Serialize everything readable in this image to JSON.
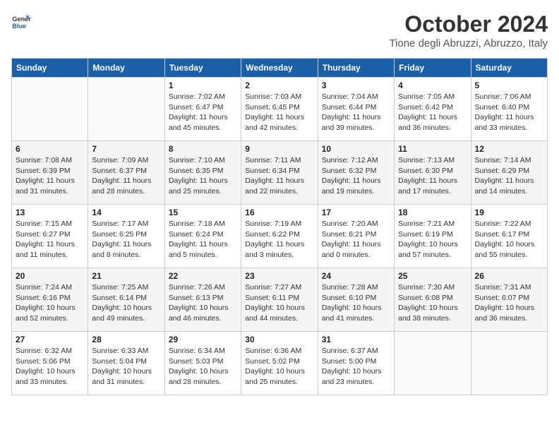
{
  "header": {
    "logo_general": "General",
    "logo_blue": "Blue",
    "month_year": "October 2024",
    "location": "Tione degli Abruzzi, Abruzzo, Italy"
  },
  "weekdays": [
    "Sunday",
    "Monday",
    "Tuesday",
    "Wednesday",
    "Thursday",
    "Friday",
    "Saturday"
  ],
  "weeks": [
    [
      {
        "day": "",
        "sunrise": "",
        "sunset": "",
        "daylight": ""
      },
      {
        "day": "",
        "sunrise": "",
        "sunset": "",
        "daylight": ""
      },
      {
        "day": "1",
        "sunrise": "Sunrise: 7:02 AM",
        "sunset": "Sunset: 6:47 PM",
        "daylight": "Daylight: 11 hours and 45 minutes."
      },
      {
        "day": "2",
        "sunrise": "Sunrise: 7:03 AM",
        "sunset": "Sunset: 6:45 PM",
        "daylight": "Daylight: 11 hours and 42 minutes."
      },
      {
        "day": "3",
        "sunrise": "Sunrise: 7:04 AM",
        "sunset": "Sunset: 6:44 PM",
        "daylight": "Daylight: 11 hours and 39 minutes."
      },
      {
        "day": "4",
        "sunrise": "Sunrise: 7:05 AM",
        "sunset": "Sunset: 6:42 PM",
        "daylight": "Daylight: 11 hours and 36 minutes."
      },
      {
        "day": "5",
        "sunrise": "Sunrise: 7:06 AM",
        "sunset": "Sunset: 6:40 PM",
        "daylight": "Daylight: 11 hours and 33 minutes."
      }
    ],
    [
      {
        "day": "6",
        "sunrise": "Sunrise: 7:08 AM",
        "sunset": "Sunset: 6:39 PM",
        "daylight": "Daylight: 11 hours and 31 minutes."
      },
      {
        "day": "7",
        "sunrise": "Sunrise: 7:09 AM",
        "sunset": "Sunset: 6:37 PM",
        "daylight": "Daylight: 11 hours and 28 minutes."
      },
      {
        "day": "8",
        "sunrise": "Sunrise: 7:10 AM",
        "sunset": "Sunset: 6:35 PM",
        "daylight": "Daylight: 11 hours and 25 minutes."
      },
      {
        "day": "9",
        "sunrise": "Sunrise: 7:11 AM",
        "sunset": "Sunset: 6:34 PM",
        "daylight": "Daylight: 11 hours and 22 minutes."
      },
      {
        "day": "10",
        "sunrise": "Sunrise: 7:12 AM",
        "sunset": "Sunset: 6:32 PM",
        "daylight": "Daylight: 11 hours and 19 minutes."
      },
      {
        "day": "11",
        "sunrise": "Sunrise: 7:13 AM",
        "sunset": "Sunset: 6:30 PM",
        "daylight": "Daylight: 11 hours and 17 minutes."
      },
      {
        "day": "12",
        "sunrise": "Sunrise: 7:14 AM",
        "sunset": "Sunset: 6:29 PM",
        "daylight": "Daylight: 11 hours and 14 minutes."
      }
    ],
    [
      {
        "day": "13",
        "sunrise": "Sunrise: 7:15 AM",
        "sunset": "Sunset: 6:27 PM",
        "daylight": "Daylight: 11 hours and 11 minutes."
      },
      {
        "day": "14",
        "sunrise": "Sunrise: 7:17 AM",
        "sunset": "Sunset: 6:25 PM",
        "daylight": "Daylight: 11 hours and 8 minutes."
      },
      {
        "day": "15",
        "sunrise": "Sunrise: 7:18 AM",
        "sunset": "Sunset: 6:24 PM",
        "daylight": "Daylight: 11 hours and 5 minutes."
      },
      {
        "day": "16",
        "sunrise": "Sunrise: 7:19 AM",
        "sunset": "Sunset: 6:22 PM",
        "daylight": "Daylight: 11 hours and 3 minutes."
      },
      {
        "day": "17",
        "sunrise": "Sunrise: 7:20 AM",
        "sunset": "Sunset: 6:21 PM",
        "daylight": "Daylight: 11 hours and 0 minutes."
      },
      {
        "day": "18",
        "sunrise": "Sunrise: 7:21 AM",
        "sunset": "Sunset: 6:19 PM",
        "daylight": "Daylight: 10 hours and 57 minutes."
      },
      {
        "day": "19",
        "sunrise": "Sunrise: 7:22 AM",
        "sunset": "Sunset: 6:17 PM",
        "daylight": "Daylight: 10 hours and 55 minutes."
      }
    ],
    [
      {
        "day": "20",
        "sunrise": "Sunrise: 7:24 AM",
        "sunset": "Sunset: 6:16 PM",
        "daylight": "Daylight: 10 hours and 52 minutes."
      },
      {
        "day": "21",
        "sunrise": "Sunrise: 7:25 AM",
        "sunset": "Sunset: 6:14 PM",
        "daylight": "Daylight: 10 hours and 49 minutes."
      },
      {
        "day": "22",
        "sunrise": "Sunrise: 7:26 AM",
        "sunset": "Sunset: 6:13 PM",
        "daylight": "Daylight: 10 hours and 46 minutes."
      },
      {
        "day": "23",
        "sunrise": "Sunrise: 7:27 AM",
        "sunset": "Sunset: 6:11 PM",
        "daylight": "Daylight: 10 hours and 44 minutes."
      },
      {
        "day": "24",
        "sunrise": "Sunrise: 7:28 AM",
        "sunset": "Sunset: 6:10 PM",
        "daylight": "Daylight: 10 hours and 41 minutes."
      },
      {
        "day": "25",
        "sunrise": "Sunrise: 7:30 AM",
        "sunset": "Sunset: 6:08 PM",
        "daylight": "Daylight: 10 hours and 38 minutes."
      },
      {
        "day": "26",
        "sunrise": "Sunrise: 7:31 AM",
        "sunset": "Sunset: 6:07 PM",
        "daylight": "Daylight: 10 hours and 36 minutes."
      }
    ],
    [
      {
        "day": "27",
        "sunrise": "Sunrise: 6:32 AM",
        "sunset": "Sunset: 5:06 PM",
        "daylight": "Daylight: 10 hours and 33 minutes."
      },
      {
        "day": "28",
        "sunrise": "Sunrise: 6:33 AM",
        "sunset": "Sunset: 5:04 PM",
        "daylight": "Daylight: 10 hours and 31 minutes."
      },
      {
        "day": "29",
        "sunrise": "Sunrise: 6:34 AM",
        "sunset": "Sunset: 5:03 PM",
        "daylight": "Daylight: 10 hours and 28 minutes."
      },
      {
        "day": "30",
        "sunrise": "Sunrise: 6:36 AM",
        "sunset": "Sunset: 5:02 PM",
        "daylight": "Daylight: 10 hours and 25 minutes."
      },
      {
        "day": "31",
        "sunrise": "Sunrise: 6:37 AM",
        "sunset": "Sunset: 5:00 PM",
        "daylight": "Daylight: 10 hours and 23 minutes."
      },
      {
        "day": "",
        "sunrise": "",
        "sunset": "",
        "daylight": ""
      },
      {
        "day": "",
        "sunrise": "",
        "sunset": "",
        "daylight": ""
      }
    ]
  ]
}
